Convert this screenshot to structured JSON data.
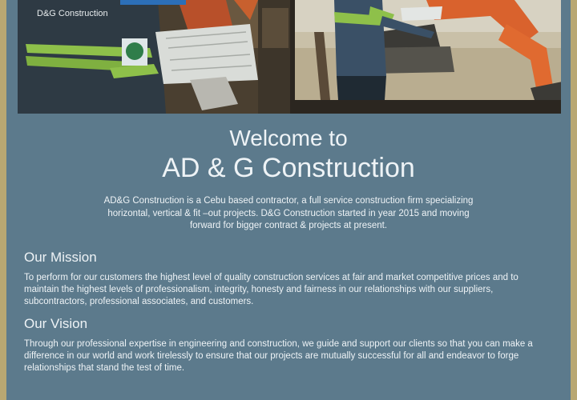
{
  "hero": {
    "left_shirt_text": "D&G Construction",
    "accent_color": "#2c6fb8"
  },
  "intro": {
    "welcome": "Welcome to",
    "company": "AD & G Construction",
    "description": "AD&G Construction is a Cebu based contractor, a full service construction firm specializing horizontal, vertical & fit –out projects. D&G Construction started in year 2015 and moving forward for bigger contract & projects at present."
  },
  "mission": {
    "heading": "Our Mission",
    "body": "To perform for our customers the highest level of quality construction services at fair and market competitive prices and to maintain the highest levels of professionalism, integrity, honesty and fairness in our relationships with our suppliers, subcontractors, professional associates, and customers."
  },
  "vision": {
    "heading": "Our Vision",
    "body": "Through our professional expertise in engineering and construction, we guide and support our clients so that you can make a difference in our world and work tirelessly to ensure that our projects are mutually successful for all and endeavor to forge relationships that stand the test of time."
  }
}
